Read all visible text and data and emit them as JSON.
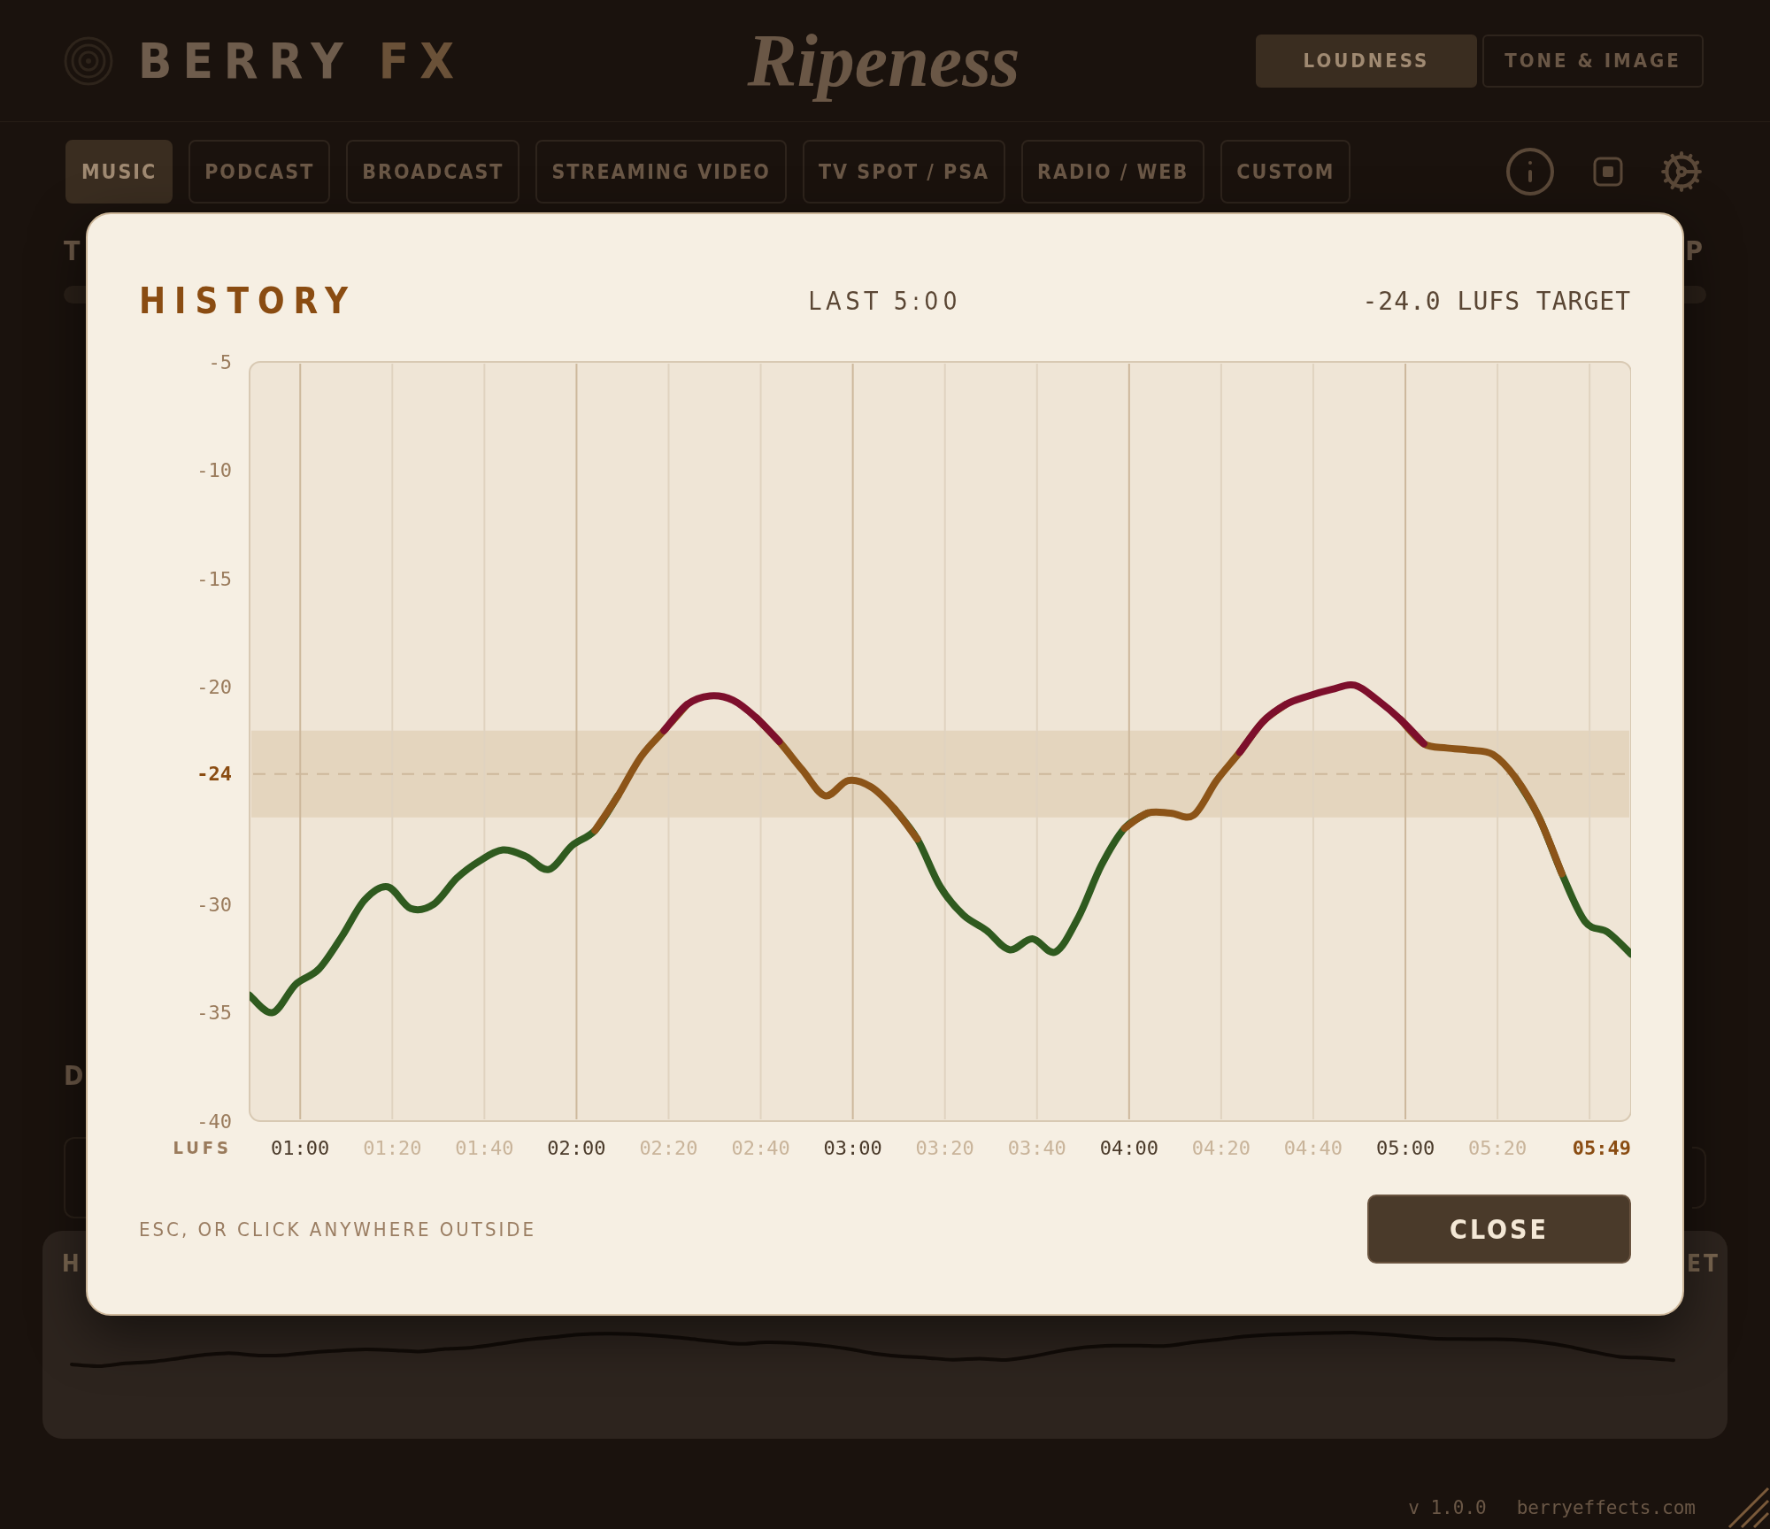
{
  "app": {
    "brand": {
      "name": "BERRY",
      "suffix": "FX"
    },
    "title": "Ripeness",
    "modes": [
      {
        "label": "LOUDNESS",
        "selected": true
      },
      {
        "label": "TONE & IMAGE",
        "selected": false
      }
    ],
    "presets": [
      {
        "label": "MUSIC",
        "selected": true
      },
      {
        "label": "PODCAST",
        "selected": false
      },
      {
        "label": "BROADCAST",
        "selected": false
      },
      {
        "label": "STREAMING VIDEO",
        "selected": false
      },
      {
        "label": "TV SPOT / PSA",
        "selected": false
      },
      {
        "label": "RADIO / WEB",
        "selected": false
      },
      {
        "label": "CUSTOM",
        "selected": false
      }
    ]
  },
  "loudness_row": {
    "label": "T",
    "side_label": "P"
  },
  "detail_row": {
    "label": "D"
  },
  "history_panel": {
    "title": "H",
    "action": "ET"
  },
  "footer": {
    "version": "v 1.0.0",
    "site": "berryeffects.com"
  },
  "modal": {
    "title": "HISTORY",
    "range": "LAST 5:00",
    "target": "-24.0 LUFS TARGET",
    "chart_data": {
      "type": "line",
      "ylabel": "LUFS",
      "xlim": [
        49,
        349
      ],
      "ylim": [
        -40,
        -5
      ],
      "grid": true,
      "x": [
        49,
        54,
        59,
        64,
        69,
        74,
        79,
        84,
        89,
        94,
        99,
        104,
        109,
        114,
        119,
        124,
        129,
        134,
        139,
        144,
        149,
        154,
        159,
        164,
        169,
        174,
        179,
        184,
        189,
        194,
        199,
        204,
        209,
        214,
        219,
        224,
        229,
        234,
        239,
        244,
        249,
        254,
        259,
        264,
        269,
        274,
        279,
        284,
        289,
        294,
        299,
        304,
        309,
        314,
        319,
        324,
        329,
        334,
        339,
        344,
        349
      ],
      "series": [
        {
          "color": "#2f5a1f",
          "values": [
            -34.2,
            -35,
            -33.7,
            -33,
            -31.5,
            -29.8,
            -29.2,
            -30.2,
            -30,
            -28.8,
            -28,
            -27.5,
            -27.8,
            -28.4,
            -27.3,
            -26.6,
            -25,
            null,
            null,
            null,
            null,
            null,
            null,
            null,
            null,
            null,
            null,
            null,
            -25.6,
            -27,
            -29.2,
            -30.5,
            -31.2,
            -32.1,
            -31.6,
            -32.2,
            -30.6,
            -28.2,
            -26.5,
            -25.8,
            null,
            null,
            null,
            null,
            null,
            null,
            null,
            null,
            null,
            null,
            null,
            null,
            null,
            null,
            null,
            -24.2,
            -26,
            -28.6,
            -30.8,
            -31.3,
            -32.3
          ]
        },
        {
          "color": "#8c5418",
          "values": [
            null,
            null,
            null,
            null,
            null,
            null,
            null,
            null,
            null,
            null,
            null,
            null,
            null,
            null,
            null,
            -26.6,
            -25,
            -23.2,
            -22,
            -20.8,
            null,
            null,
            -21.4,
            -22.5,
            -23.8,
            -25,
            -24.3,
            -24.6,
            -25.6,
            -27,
            null,
            null,
            null,
            null,
            null,
            null,
            null,
            null,
            -26.5,
            -25.8,
            -25.8,
            -25.9,
            -24.3,
            -23,
            -21.6,
            -20.8,
            null,
            null,
            null,
            null,
            -21.5,
            -22.6,
            -22.8,
            -22.9,
            -23.1,
            -24.2,
            -26,
            -28.6,
            null,
            null,
            null
          ]
        },
        {
          "color": "#7d0f2c",
          "values": [
            null,
            null,
            null,
            null,
            null,
            null,
            null,
            null,
            null,
            null,
            null,
            null,
            null,
            null,
            null,
            null,
            null,
            null,
            -22,
            -20.8,
            -20.4,
            -20.6,
            -21.4,
            -22.5,
            null,
            null,
            null,
            null,
            null,
            null,
            null,
            null,
            null,
            null,
            null,
            null,
            null,
            null,
            null,
            null,
            null,
            null,
            null,
            -23,
            -21.6,
            -20.8,
            -20.4,
            -20.1,
            -19.9,
            -20.6,
            -21.5,
            -22.6,
            null,
            null,
            null,
            null,
            null,
            null,
            null,
            null,
            null
          ]
        }
      ],
      "xticks": [
        {
          "value": 60,
          "label": "01:00"
        },
        {
          "value": 80,
          "label": "01:20"
        },
        {
          "value": 100,
          "label": "01:40"
        },
        {
          "value": 120,
          "label": "02:00"
        },
        {
          "value": 140,
          "label": "02:20"
        },
        {
          "value": 160,
          "label": "02:40"
        },
        {
          "value": 180,
          "label": "03:00"
        },
        {
          "value": 200,
          "label": "03:20"
        },
        {
          "value": 220,
          "label": "03:40"
        },
        {
          "value": 240,
          "label": "04:00"
        },
        {
          "value": 260,
          "label": "04:20"
        },
        {
          "value": 280,
          "label": "04:40"
        },
        {
          "value": 300,
          "label": "05:00"
        },
        {
          "value": 320,
          "label": "05:20"
        },
        {
          "value": 349,
          "label": "05:49"
        }
      ],
      "yticks": [
        -5,
        -10,
        -15,
        -20,
        -24,
        -30,
        -35,
        -40
      ],
      "bands": [
        {
          "axis": "y",
          "from": -26,
          "to": -22
        }
      ],
      "ref_lines": [
        {
          "axis": "y",
          "value": -24
        }
      ]
    },
    "hint": "ESC, OR CLICK ANYWHERE OUTSIDE",
    "close": "CLOSE"
  }
}
